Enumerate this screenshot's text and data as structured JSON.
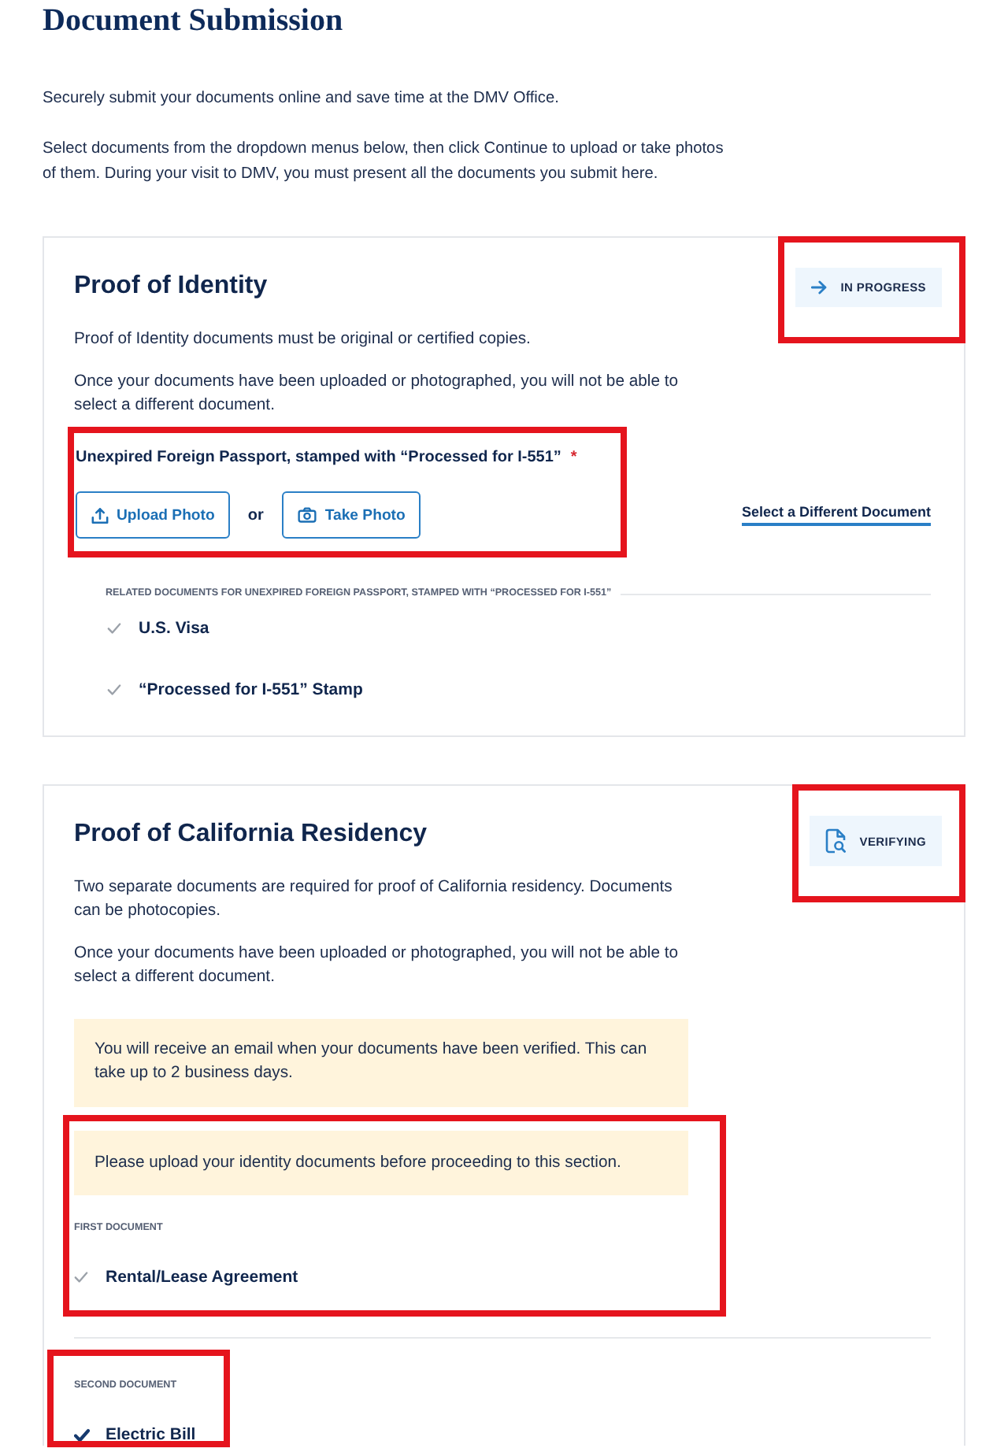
{
  "page": {
    "title": "Document Submission",
    "intro": [
      "Securely submit your documents online and save time at the DMV Office.",
      "Select documents from the dropdown menus below, then click Continue to upload or take photos of them. During your visit to DMV, you must present all the documents you submit here."
    ]
  },
  "sections": [
    {
      "title": "Proof of Identity",
      "status": {
        "kind": "in_progress",
        "label": "IN PROGRESS",
        "highlighted": true
      },
      "paragraphs": [
        "Proof of Identity documents must be original or certified copies.",
        "Once your documents have been uploaded or photographed, you will not be able to select a different document."
      ],
      "content": [
        {
          "kind": "document",
          "label": "Unexpired Foreign Passport, stamped with “Processed for I-551”",
          "required_mark": "*",
          "highlighted": true,
          "buttons": [
            {
              "kind": "upload",
              "label": "Upload Photo"
            },
            {
              "kind": "camera",
              "label": "Take Photo"
            }
          ],
          "separator": "or",
          "link": "Select a Different Document"
        },
        {
          "kind": "related",
          "heading": "RELATED DOCUMENTS FOR UNEXPIRED FOREIGN PASSPORT, STAMPED WITH “PROCESSED FOR I-551”",
          "items": [
            {
              "label": "U.S. Visa",
              "checked": false
            },
            {
              "label": "“Processed for I-551” Stamp",
              "checked": false
            }
          ]
        }
      ]
    },
    {
      "title": "Proof of California Residency",
      "status": {
        "kind": "verifying",
        "label": "VERIFYING",
        "highlighted": true
      },
      "paragraphs": [
        "Two separate documents are required for proof of California residency. Documents can be photocopies.",
        "Once your documents have been uploaded or photographed, you will not be able to select a different document."
      ],
      "content": [
        {
          "kind": "notice",
          "text": "You will receive an email when your documents have been verified. This can take up to 2 business days."
        },
        {
          "kind": "group",
          "highlighted": true,
          "content": [
            {
              "kind": "notice",
              "text": "Please upload your identity documents before proceeding to this section."
            },
            {
              "kind": "slot",
              "heading": "FIRST DOCUMENT",
              "items": [
                {
                  "label": "Rental/Lease Agreement",
                  "checked": false
                }
              ]
            }
          ]
        },
        {
          "kind": "slot",
          "heading": "SECOND DOCUMENT",
          "highlighted": true,
          "items": [
            {
              "label": "Electric Bill",
              "checked": true
            }
          ]
        }
      ]
    }
  ]
}
